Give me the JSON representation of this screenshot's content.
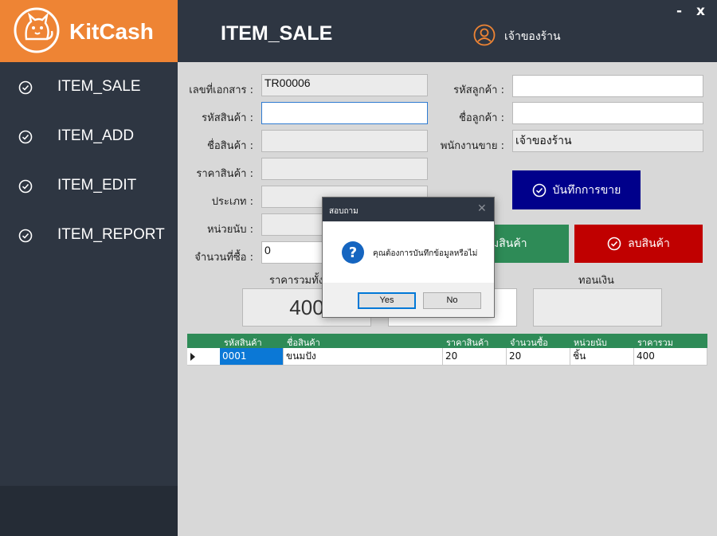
{
  "app": {
    "brand": "KitCash",
    "minimize": "-",
    "close": "x"
  },
  "sidebar": {
    "items": [
      {
        "label": "ITEM_SALE"
      },
      {
        "label": "ITEM_ADD"
      },
      {
        "label": "ITEM_EDIT"
      },
      {
        "label": "ITEM_REPORT"
      }
    ]
  },
  "header": {
    "title": "ITEM_SALE",
    "user": "เจ้าของร้าน"
  },
  "form": {
    "doc_no_label": "เลขที่เอกสาร :",
    "doc_no": "TR00006",
    "product_code_label": "รหัสสินค้า :",
    "product_code": "",
    "product_name_label": "ชื่อสินค้า :",
    "product_name": "",
    "price_label": "ราคาสินค้า :",
    "price": "",
    "type_label": "ประเภท :",
    "type": "",
    "unit_label": "หน่วยนับ :",
    "unit": "",
    "qty_label": "จำนวนที่ซื้อ :",
    "qty": "0",
    "customer_code_label": "รหัสลูกค้า :",
    "customer_code": "",
    "customer_name_label": "ชื่อลูกค้า :",
    "customer_name": "",
    "seller_label": "พนักงานขาย :",
    "seller": "เจ้าของร้าน"
  },
  "buttons": {
    "save_sale": "บันทึกการขาย",
    "add_item": "มสินค้า",
    "delete_item": "ลบสินค้า"
  },
  "summary": {
    "total_label": "ราคารวมทั้ง",
    "total": "400",
    "change_label": "ทอนเงิน",
    "change": "",
    "paid": ""
  },
  "grid": {
    "columns": [
      "รหัสสินค้า",
      "ชื่อสินค้า",
      "ราคาสินค้า",
      "จำนวนซื้อ",
      "หน่วยนับ",
      "ราคารวม"
    ],
    "rows": [
      {
        "code": "0001",
        "name": "ขนมปัง",
        "price": "20",
        "qty": "20",
        "unit": "ชิ้น",
        "total": "400"
      }
    ]
  },
  "dialog": {
    "title": "สอบถาม",
    "message": "คุณต้องการบันทึกข้อมูลหรือไม่",
    "yes": "Yes",
    "no": "No"
  },
  "colors": {
    "brand_orange": "#ee8434",
    "sidebar": "#2e3642",
    "save_blue": "#00008b",
    "add_green": "#2e8b57",
    "delete_red": "#c00000"
  }
}
